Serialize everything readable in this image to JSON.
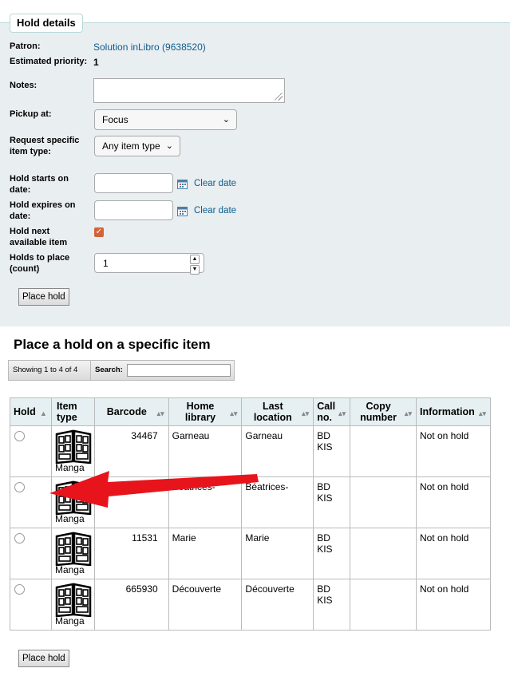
{
  "form": {
    "legend": "Hold details",
    "patron": {
      "label": "Patron:",
      "value": "Solution inLibro (9638520)"
    },
    "priority": {
      "label": "Estimated priority:",
      "value": "1"
    },
    "notes": {
      "label": "Notes:"
    },
    "pickup": {
      "label": "Pickup at:",
      "value": "Focus"
    },
    "item_type": {
      "label": "Request specific item type:",
      "value": "Any item type"
    },
    "starts": {
      "label": "Hold starts on date:",
      "clear": "Clear date"
    },
    "expires": {
      "label": "Hold expires on date:",
      "clear": "Clear date"
    },
    "next_available": {
      "label": "Hold next available item",
      "checked": true
    },
    "count": {
      "label": "Holds to place (count)",
      "value": "1"
    },
    "submit": "Place hold"
  },
  "specific": {
    "heading": "Place a hold on a specific item",
    "showing": "Showing 1 to 4 of 4",
    "search_label": "Search:",
    "columns": [
      "Hold",
      "Item type",
      "Barcode",
      "Home library",
      "Last location",
      "Call no.",
      "Copy number",
      "Information"
    ],
    "rows": [
      {
        "itype": "Manga",
        "barcode": "34467",
        "home": "Garneau",
        "last": "Garneau",
        "call": "BD KIS",
        "copy": "",
        "info": "Not on hold"
      },
      {
        "itype": "Manga",
        "barcode": "",
        "home": "Béatrices-",
        "last": "Béatrices-",
        "call": "BD KIS",
        "copy": "",
        "info": "Not on hold"
      },
      {
        "itype": "Manga",
        "barcode": "11531",
        "home": "Marie",
        "last": "Marie",
        "call": "BD KIS",
        "copy": "",
        "info": "Not on hold"
      },
      {
        "itype": "Manga",
        "barcode": "665930",
        "home": "Découverte",
        "last": "Découverte",
        "call": "BD KIS",
        "copy": "",
        "info": "Not on hold"
      }
    ],
    "submit": "Place hold"
  },
  "icons": {
    "calendar": "calendar-icon",
    "manga": "manga-itemtype-icon",
    "arrow": "red-annotation-arrow"
  },
  "colors": {
    "link": "#0d5c8c",
    "fieldset_bg": "#e9eef1",
    "header_bg": "#e6f0f2",
    "arrow": "#e8141c",
    "checkbox": "#d2643c"
  }
}
